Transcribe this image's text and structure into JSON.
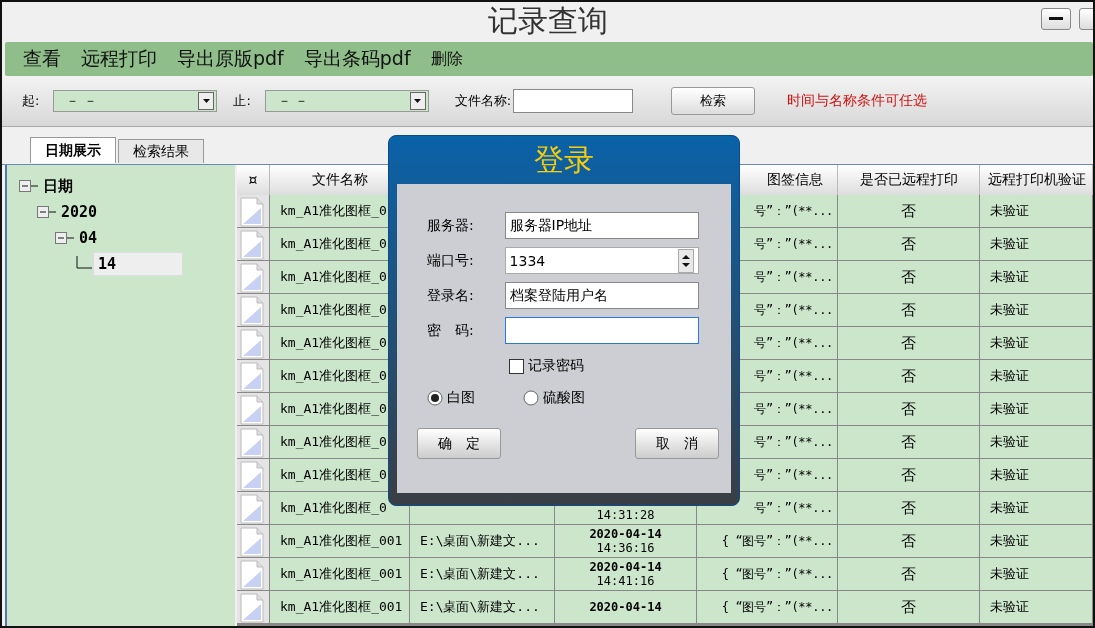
{
  "window": {
    "title": "记录查询"
  },
  "menu": [
    "查看",
    "远程打印",
    "导出原版pdf",
    "导出条码pdf",
    "删除"
  ],
  "filters": {
    "from_label": "起:",
    "from_value": "－ －",
    "to_label": "止:",
    "to_value": "－ －",
    "name_label": "文件名称:",
    "search_button": "检索",
    "hint": "时间与名称条件可任选"
  },
  "tabs": [
    {
      "label": "日期展示",
      "selected": true
    },
    {
      "label": "检索结果",
      "selected": false
    }
  ],
  "tree": [
    {
      "label": "日期",
      "expanded": true,
      "selected": false,
      "children": [
        {
          "label": "2020",
          "expanded": true,
          "selected": false,
          "children": [
            {
              "label": "04",
              "expanded": true,
              "selected": false,
              "children": [
                {
                  "label": "14",
                  "selected": true
                }
              ]
            }
          ]
        }
      ]
    }
  ],
  "table": {
    "columns": [
      "¤",
      "文件名称",
      "图签信息",
      "是否已远程打印",
      "远程打印机验证"
    ],
    "rows": [
      {
        "name": "km_A1准化图框_0",
        "info": "号”：”(**...",
        "printed": "否",
        "verified": "未验证"
      },
      {
        "name": "km_A1准化图框_0",
        "info": "号”：”(**...",
        "printed": "否",
        "verified": "未验证"
      },
      {
        "name": "km_A1准化图框_0",
        "info": "号”：”(**...",
        "printed": "否",
        "verified": "未验证"
      },
      {
        "name": "km_A1准化图框_0",
        "info": "号”：”(**...",
        "printed": "否",
        "verified": "未验证"
      },
      {
        "name": "km_A1准化图框_0",
        "info": "号”：”(**...",
        "printed": "否",
        "verified": "未验证"
      },
      {
        "name": "km_A1准化图框_0",
        "info": "号”：”(**...",
        "printed": "否",
        "verified": "未验证"
      },
      {
        "name": "km_A1准化图框_0",
        "info": "号”：”(**...",
        "printed": "否",
        "verified": "未验证"
      },
      {
        "name": "km_A1准化图框_0",
        "info": "号”：”(**...",
        "printed": "否",
        "verified": "未验证"
      },
      {
        "name": "km_A1准化图框_0",
        "info": "号”：”(**...",
        "printed": "否",
        "verified": "未验证"
      },
      {
        "name": "km_A1准化图框_0",
        "time": "14:31:28",
        "info": "号”：”(**...",
        "printed": "否",
        "verified": "未验证"
      },
      {
        "name": "km_A1准化图框_001",
        "path": "E:\\桌面\\新建文...",
        "date": "2020-04-14",
        "time": "14:36:16",
        "info": "{ “图号”：”(**...",
        "printed": "否",
        "verified": "未验证"
      },
      {
        "name": "km_A1准化图框_001",
        "path": "E:\\桌面\\新建文...",
        "date": "2020-04-14",
        "time": "14:41:16",
        "info": "{ “图号”：”(**...",
        "printed": "否",
        "verified": "未验证"
      },
      {
        "name": "km_A1准化图框_001",
        "path": "E:\\桌面\\新建文...",
        "date": "2020-04-14",
        "info": "{ “图号”：”(**...",
        "printed": "否",
        "verified": "未验证"
      }
    ]
  },
  "login_dialog": {
    "title": "登录",
    "fields": [
      {
        "label": "服务器:",
        "value": "服务器IP地址",
        "kind": "text"
      },
      {
        "label": "端口号:",
        "value": "1334",
        "kind": "spin"
      },
      {
        "label": "登录名:",
        "value": "档案登陆用户名",
        "kind": "text"
      },
      {
        "label": "密　码:",
        "kind": "password",
        "focused": true
      }
    ],
    "remember": {
      "label": "记录密码",
      "checked": false
    },
    "options": [
      {
        "label": "白图",
        "selected": true
      },
      {
        "label": "硫酸图",
        "selected": false
      }
    ],
    "buttons": [
      "确　定",
      "取　消"
    ]
  }
}
